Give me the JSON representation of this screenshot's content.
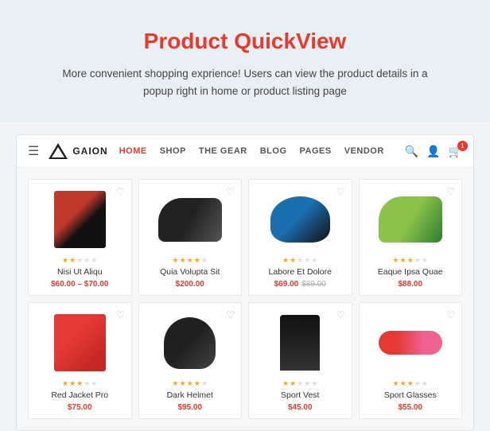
{
  "hero": {
    "title_plain": "Product ",
    "title_highlight": "QuickView",
    "description": "More convenient shopping exprience! Users can view the product details in a popup right in home or product listing page"
  },
  "nav": {
    "logo_text": "GAION",
    "links": [
      {
        "label": "HOME",
        "active": true
      },
      {
        "label": "SHOP",
        "active": false
      },
      {
        "label": "THE GEAR",
        "active": false
      },
      {
        "label": "BLOG",
        "active": false
      },
      {
        "label": "PAGES",
        "active": false
      },
      {
        "label": "VENDOR",
        "active": false
      }
    ],
    "cart_count": "1"
  },
  "products": [
    {
      "name": "Nisi Ut Aliqu",
      "price": "$60.00 – $70.00",
      "old_price": "",
      "stars": [
        1,
        1,
        0,
        0,
        0
      ],
      "img_type": "jacket"
    },
    {
      "name": "Quia Volupta Sit",
      "price": "$200.00",
      "old_price": "",
      "stars": [
        1,
        1,
        1,
        1,
        0
      ],
      "img_type": "shoe"
    },
    {
      "name": "Labore Et Dolore",
      "price": "$69.00",
      "old_price": "$89.00",
      "stars": [
        1,
        1,
        0,
        0,
        0
      ],
      "img_type": "helmet"
    },
    {
      "name": "Eaque Ipsa Quae",
      "price": "$88.00",
      "old_price": "",
      "stars": [
        1,
        1,
        1,
        0,
        0
      ],
      "img_type": "shoe2"
    },
    {
      "name": "Red Jacket Pro",
      "price": "$75.00",
      "old_price": "",
      "stars": [
        1,
        1,
        1,
        0,
        0
      ],
      "img_type": "jacket2"
    },
    {
      "name": "Dark Helmet",
      "price": "$95.00",
      "old_price": "",
      "stars": [
        1,
        1,
        1,
        1,
        0
      ],
      "img_type": "helmet2"
    },
    {
      "name": "Sport Vest",
      "price": "$45.00",
      "old_price": "",
      "stars": [
        1,
        1,
        0,
        0,
        0
      ],
      "img_type": "vest"
    },
    {
      "name": "Sport Glasses",
      "price": "$55.00",
      "old_price": "",
      "stars": [
        1,
        1,
        1,
        0,
        0
      ],
      "img_type": "glasses"
    }
  ]
}
